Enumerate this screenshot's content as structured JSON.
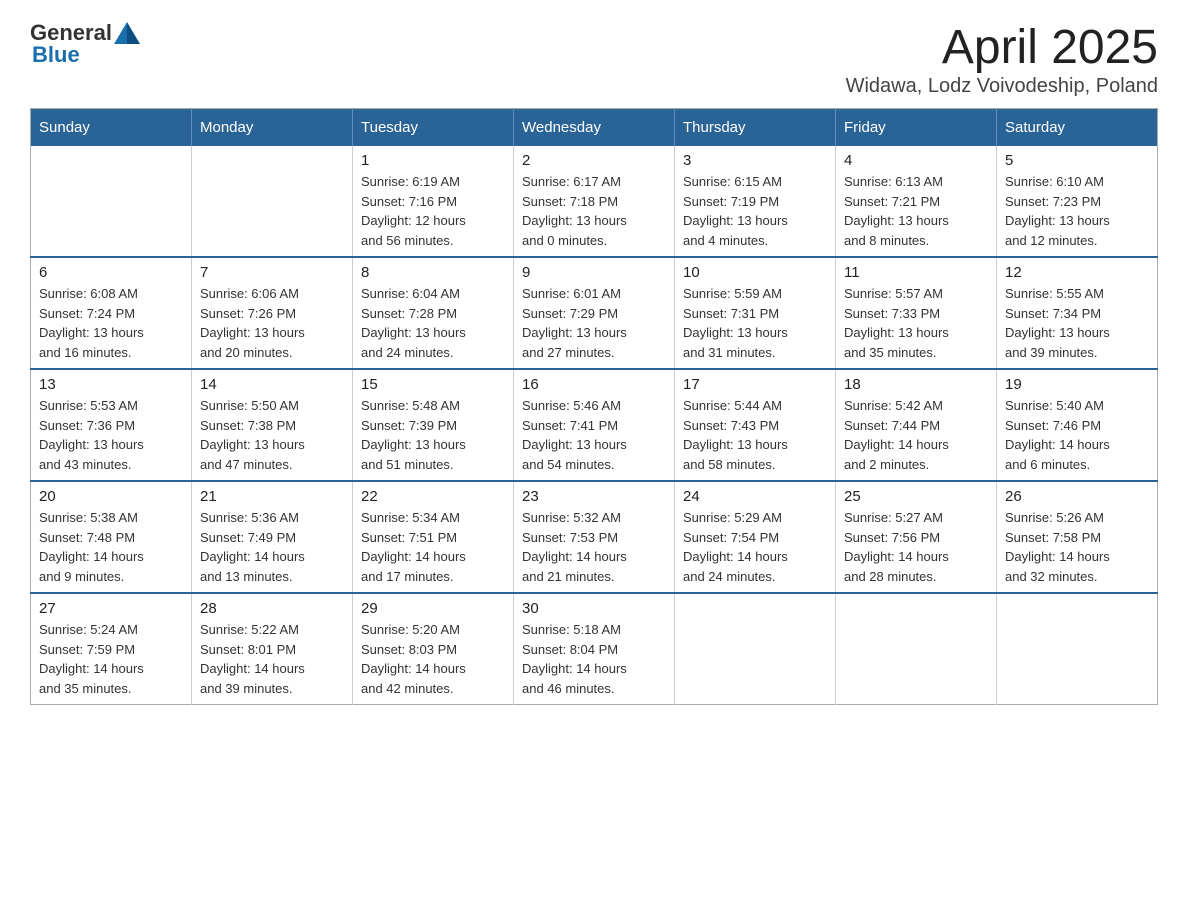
{
  "header": {
    "logo_general": "General",
    "logo_blue": "Blue",
    "title": "April 2025",
    "subtitle": "Widawa, Lodz Voivodeship, Poland"
  },
  "calendar": {
    "days_of_week": [
      "Sunday",
      "Monday",
      "Tuesday",
      "Wednesday",
      "Thursday",
      "Friday",
      "Saturday"
    ],
    "weeks": [
      [
        {
          "day": "",
          "info": ""
        },
        {
          "day": "",
          "info": ""
        },
        {
          "day": "1",
          "info": "Sunrise: 6:19 AM\nSunset: 7:16 PM\nDaylight: 12 hours\nand 56 minutes."
        },
        {
          "day": "2",
          "info": "Sunrise: 6:17 AM\nSunset: 7:18 PM\nDaylight: 13 hours\nand 0 minutes."
        },
        {
          "day": "3",
          "info": "Sunrise: 6:15 AM\nSunset: 7:19 PM\nDaylight: 13 hours\nand 4 minutes."
        },
        {
          "day": "4",
          "info": "Sunrise: 6:13 AM\nSunset: 7:21 PM\nDaylight: 13 hours\nand 8 minutes."
        },
        {
          "day": "5",
          "info": "Sunrise: 6:10 AM\nSunset: 7:23 PM\nDaylight: 13 hours\nand 12 minutes."
        }
      ],
      [
        {
          "day": "6",
          "info": "Sunrise: 6:08 AM\nSunset: 7:24 PM\nDaylight: 13 hours\nand 16 minutes."
        },
        {
          "day": "7",
          "info": "Sunrise: 6:06 AM\nSunset: 7:26 PM\nDaylight: 13 hours\nand 20 minutes."
        },
        {
          "day": "8",
          "info": "Sunrise: 6:04 AM\nSunset: 7:28 PM\nDaylight: 13 hours\nand 24 minutes."
        },
        {
          "day": "9",
          "info": "Sunrise: 6:01 AM\nSunset: 7:29 PM\nDaylight: 13 hours\nand 27 minutes."
        },
        {
          "day": "10",
          "info": "Sunrise: 5:59 AM\nSunset: 7:31 PM\nDaylight: 13 hours\nand 31 minutes."
        },
        {
          "day": "11",
          "info": "Sunrise: 5:57 AM\nSunset: 7:33 PM\nDaylight: 13 hours\nand 35 minutes."
        },
        {
          "day": "12",
          "info": "Sunrise: 5:55 AM\nSunset: 7:34 PM\nDaylight: 13 hours\nand 39 minutes."
        }
      ],
      [
        {
          "day": "13",
          "info": "Sunrise: 5:53 AM\nSunset: 7:36 PM\nDaylight: 13 hours\nand 43 minutes."
        },
        {
          "day": "14",
          "info": "Sunrise: 5:50 AM\nSunset: 7:38 PM\nDaylight: 13 hours\nand 47 minutes."
        },
        {
          "day": "15",
          "info": "Sunrise: 5:48 AM\nSunset: 7:39 PM\nDaylight: 13 hours\nand 51 minutes."
        },
        {
          "day": "16",
          "info": "Sunrise: 5:46 AM\nSunset: 7:41 PM\nDaylight: 13 hours\nand 54 minutes."
        },
        {
          "day": "17",
          "info": "Sunrise: 5:44 AM\nSunset: 7:43 PM\nDaylight: 13 hours\nand 58 minutes."
        },
        {
          "day": "18",
          "info": "Sunrise: 5:42 AM\nSunset: 7:44 PM\nDaylight: 14 hours\nand 2 minutes."
        },
        {
          "day": "19",
          "info": "Sunrise: 5:40 AM\nSunset: 7:46 PM\nDaylight: 14 hours\nand 6 minutes."
        }
      ],
      [
        {
          "day": "20",
          "info": "Sunrise: 5:38 AM\nSunset: 7:48 PM\nDaylight: 14 hours\nand 9 minutes."
        },
        {
          "day": "21",
          "info": "Sunrise: 5:36 AM\nSunset: 7:49 PM\nDaylight: 14 hours\nand 13 minutes."
        },
        {
          "day": "22",
          "info": "Sunrise: 5:34 AM\nSunset: 7:51 PM\nDaylight: 14 hours\nand 17 minutes."
        },
        {
          "day": "23",
          "info": "Sunrise: 5:32 AM\nSunset: 7:53 PM\nDaylight: 14 hours\nand 21 minutes."
        },
        {
          "day": "24",
          "info": "Sunrise: 5:29 AM\nSunset: 7:54 PM\nDaylight: 14 hours\nand 24 minutes."
        },
        {
          "day": "25",
          "info": "Sunrise: 5:27 AM\nSunset: 7:56 PM\nDaylight: 14 hours\nand 28 minutes."
        },
        {
          "day": "26",
          "info": "Sunrise: 5:26 AM\nSunset: 7:58 PM\nDaylight: 14 hours\nand 32 minutes."
        }
      ],
      [
        {
          "day": "27",
          "info": "Sunrise: 5:24 AM\nSunset: 7:59 PM\nDaylight: 14 hours\nand 35 minutes."
        },
        {
          "day": "28",
          "info": "Sunrise: 5:22 AM\nSunset: 8:01 PM\nDaylight: 14 hours\nand 39 minutes."
        },
        {
          "day": "29",
          "info": "Sunrise: 5:20 AM\nSunset: 8:03 PM\nDaylight: 14 hours\nand 42 minutes."
        },
        {
          "day": "30",
          "info": "Sunrise: 5:18 AM\nSunset: 8:04 PM\nDaylight: 14 hours\nand 46 minutes."
        },
        {
          "day": "",
          "info": ""
        },
        {
          "day": "",
          "info": ""
        },
        {
          "day": "",
          "info": ""
        }
      ]
    ]
  }
}
